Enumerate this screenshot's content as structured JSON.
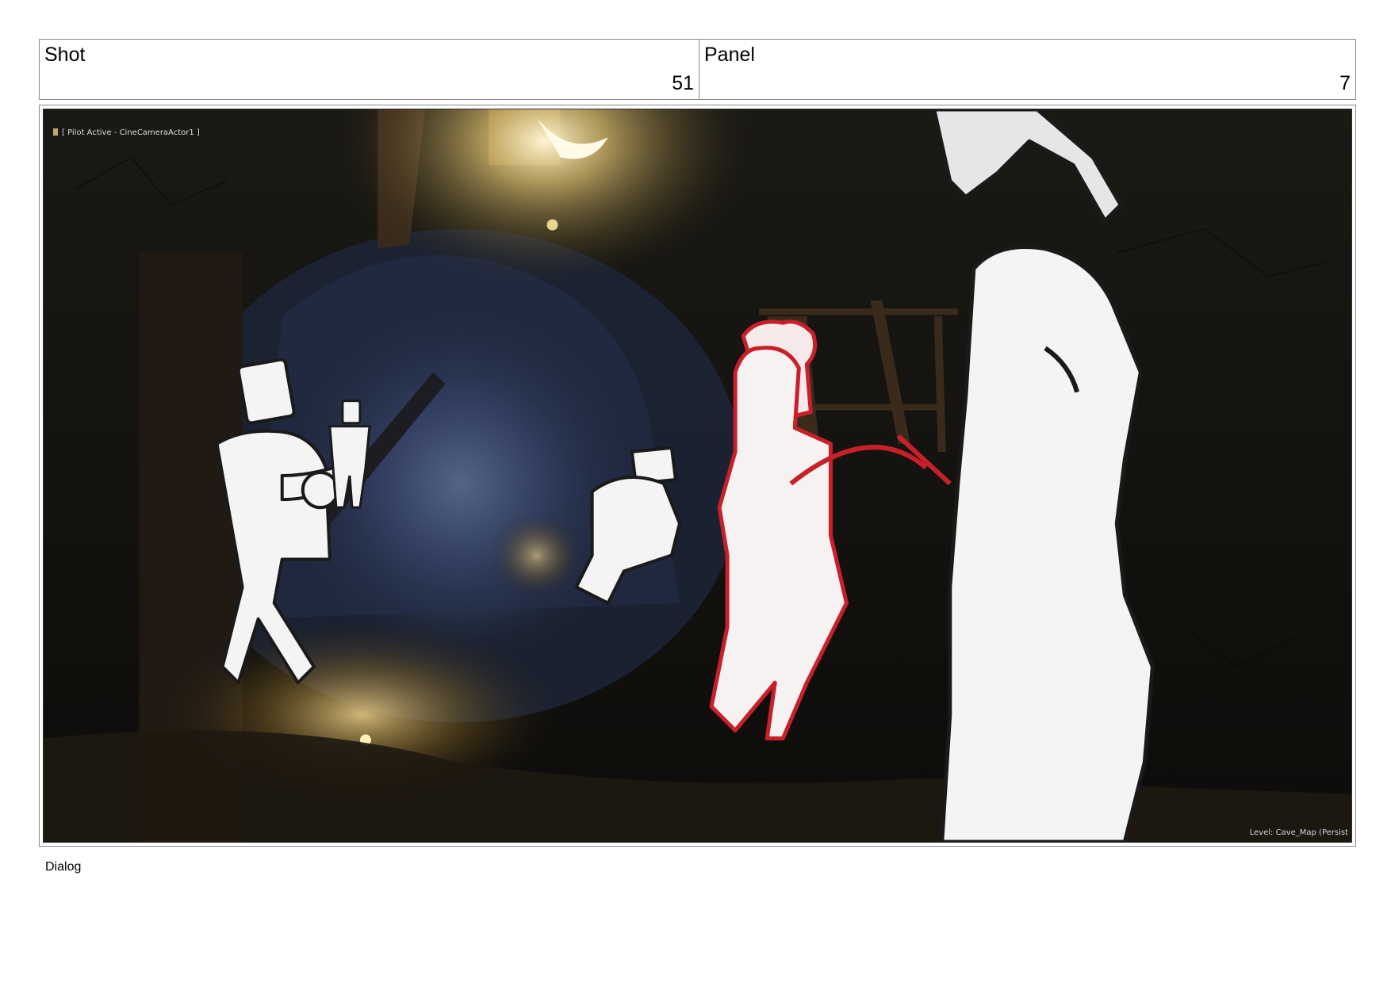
{
  "header": {
    "shot_label": "Shot",
    "shot_number": "51",
    "panel_label": "Panel",
    "panel_number": "7"
  },
  "frame": {
    "pilot_status": "[ Pilot Active - CineCameraActor1 ]",
    "level_label": "Level:",
    "level_name": "Cave_Map (Persist"
  },
  "dialog": {
    "label": "Dialog"
  },
  "colors": {
    "border": "#8a8a8a",
    "sketch_red": "#c8202a",
    "sketch_white": "#f4f4f4",
    "cave_dark": "#14130f",
    "tunnel_blue": "#5a6e9a",
    "lamp_glow": "#ffe9a8"
  }
}
